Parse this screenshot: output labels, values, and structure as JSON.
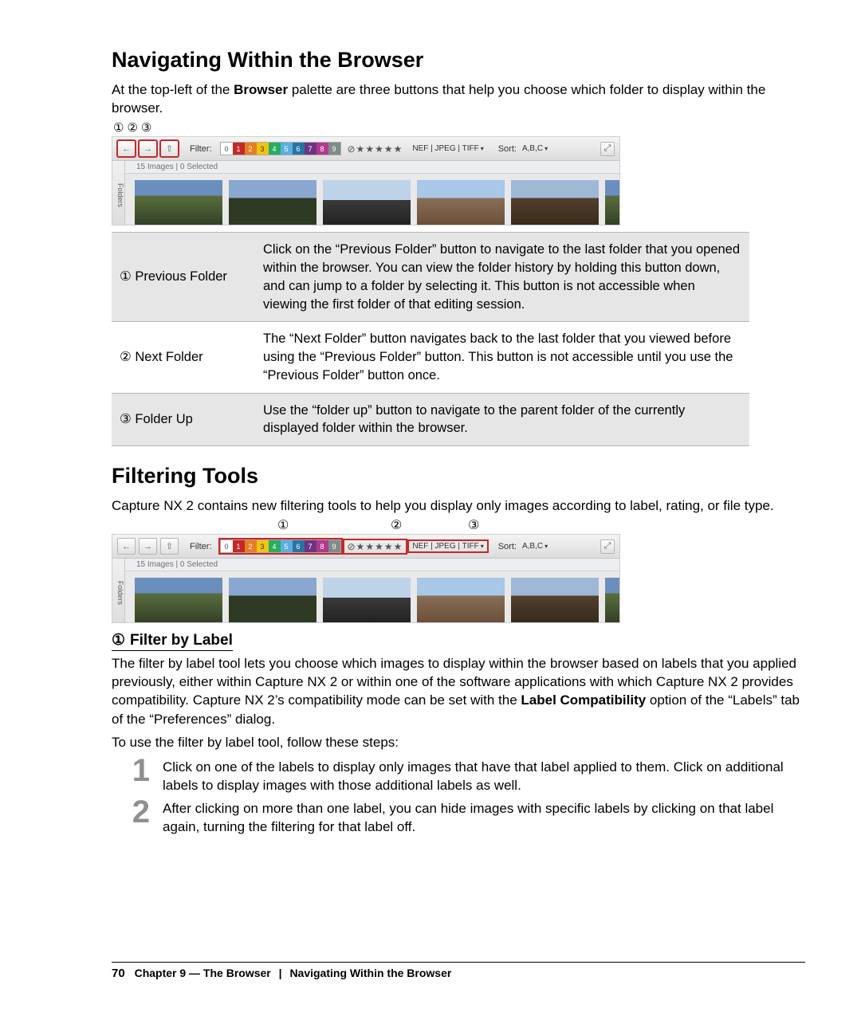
{
  "section1": {
    "title": "Navigating Within the Browser",
    "intro_a": "At the top-left of the ",
    "intro_b": "Browser",
    "intro_c": " palette are three buttons that help you choose which folder to display within the browser."
  },
  "screenshot": {
    "filter_label": "Filter:",
    "sort_label": "Sort:",
    "sort_value": "A,B,C",
    "filetypes": "NEF | JPEG | TIFF",
    "stars": "⊘★★★★★",
    "status": "15 Images | 0 Selected",
    "side": "Folders",
    "labels": [
      "0",
      "1",
      "2",
      "3",
      "4",
      "5",
      "6",
      "7",
      "8",
      "9"
    ]
  },
  "markers": {
    "m1": "①",
    "m2": "②",
    "m3": "③"
  },
  "table1": [
    {
      "k": "① Previous Folder",
      "v": "Click on the “Previous Folder” button to navigate to the last folder that you opened within the browser. You can view the folder history by holding this button down, and can jump to a folder by selecting it. This button is not accessible when viewing the first folder of that editing session."
    },
    {
      "k": "② Next Folder",
      "v": "The “Next Folder” button navigates back to the last folder that you viewed before using the “Previous Folder” button. This button is not accessible until you use the “Previous Folder” button once."
    },
    {
      "k": "③ Folder Up",
      "v": "Use the “folder up” button to navigate to the parent folder of the currently displayed folder within the browser."
    }
  ],
  "section2": {
    "title": "Filtering Tools",
    "intro": "Capture NX 2 contains new filtering tools to help you display only images according to label, rating, or file type."
  },
  "sub1": {
    "num": "①",
    "title": "Filter by Label",
    "p1_a": "The filter by label tool lets you choose which images to display within the browser based on labels that you applied previously, either within Capture NX 2 or within one of the software applications with which Capture NX 2 provides compatibility. Capture NX 2’s compatibility mode can be set with the ",
    "p1_b": "Label Compatibility",
    "p1_c": " option of the “Labels” tab of the “Preferences” dialog.",
    "p2": "To use the filter by label tool, follow these steps:"
  },
  "steps": [
    {
      "n": "1",
      "t": "Click on one of the labels to display only images that have that label applied to them. Click on additional labels to display images with those additional labels as well."
    },
    {
      "n": "2",
      "t": "After clicking on more than one label, you can hide images with specific labels by clicking on that label again, turning the filtering for that label off."
    }
  ],
  "footer": {
    "page": "70",
    "chapter_a": "Chapter 9 — The Browser",
    "chapter_b": "Navigating Within the Browser"
  },
  "chart_data": null
}
